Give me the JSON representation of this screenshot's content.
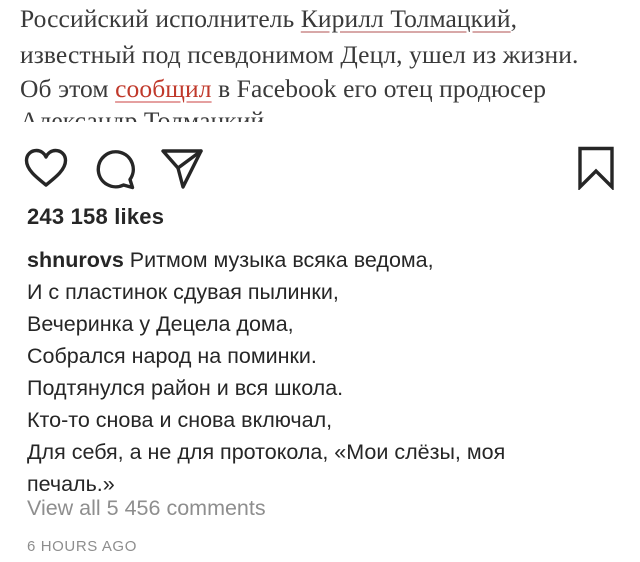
{
  "article": {
    "line1_pre": "Российский исполнитель ",
    "line1_name": "Кирилл Толмацкий",
    "line1_post": ",",
    "line2": "известный под псевдонимом Децл, ушел из жизни.",
    "line3_pre": "Об этом ",
    "line3_link": "сообщил",
    "line3_post": " в Facebook его отец продюсер",
    "line4": "Александр Толмацкий."
  },
  "actions": {
    "icons": [
      "heart-icon",
      "comment-icon",
      "share-icon",
      "bookmark-icon"
    ]
  },
  "likes": "243 158 likes",
  "caption": {
    "username": "shnurovs",
    "lines": [
      "Ритмом музыка всяка ведома,",
      "И с пластинок сдувая пылинки,",
      "Вечеринка у Децела дома,",
      "Собрался народ на поминки.",
      "Подтянулся район и вся школа.",
      "Кто-то снова и снова включал,",
      "Для себя, а не для протокола, «Мои слёзы, моя",
      "печаль.»"
    ]
  },
  "view_comments": "View all 5 456 comments",
  "timestamp": "6 HOURS AGO"
}
